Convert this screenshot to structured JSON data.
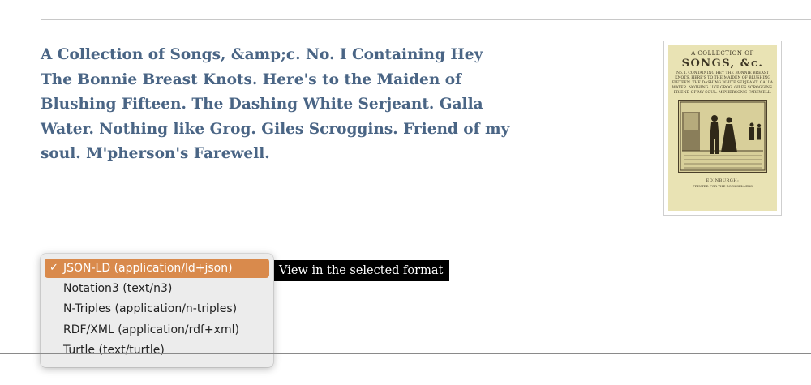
{
  "record": {
    "title": "A Collection of Songs, &amp;c. No. I Containing Hey The Bonnie Breast Knots. Here's to the Maiden of Blushing Fifteen. The Dashing White Serjeant. Galla Water. Nothing like Grog. Giles Scroggins. Friend of my soul. M'pherson's Farewell."
  },
  "thumbnail": {
    "line1": "A COLLECTION OF",
    "line2": "SONGS, &c.",
    "contents": "No. I. CONTAINING HEY THE BONNIE BREAST KNOTS. HERE'S TO THE MAIDEN OF BLUSHING FIFTEEN. THE DASHING WHITE SERJEANT. GALLA WATER. NOTHING LIKE GROG. GILES SCROGGINS. FRIEND OF MY SOUL. M'PHERSON'S FAREWELL.",
    "place": "EDINBURGH:",
    "printer": "PRINTED FOR THE BOOKSELLERS"
  },
  "format_select": {
    "options": [
      {
        "label": "JSON-LD (application/ld+json)",
        "selected": true
      },
      {
        "label": "Notation3 (text/n3)",
        "selected": false
      },
      {
        "label": "N-Triples (application/n-triples)",
        "selected": false
      },
      {
        "label": "RDF/XML (application/rdf+xml)",
        "selected": false
      },
      {
        "label": "Turtle (text/turtle)",
        "selected": false
      }
    ],
    "check_glyph": "✓",
    "selected_color": "#d98a4c"
  },
  "view_button": {
    "label": "View in the selected format"
  },
  "colors": {
    "title": "#4a6585",
    "button_bg": "#000000"
  }
}
